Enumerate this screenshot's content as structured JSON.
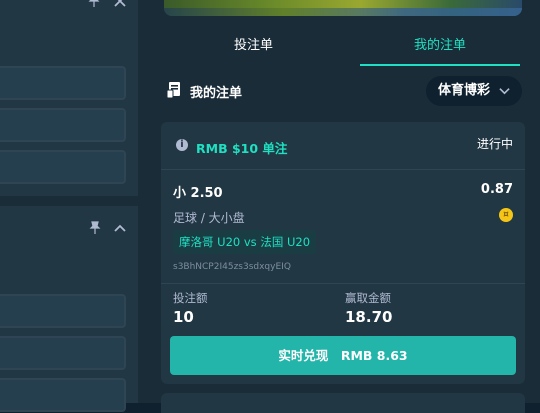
{
  "tabs": {
    "place_bet": "投注单",
    "my_bets": "我的注单"
  },
  "my_bets_header": {
    "label": "我的注单",
    "icon": "receipt-icon"
  },
  "filter": {
    "selected": "体育博彩"
  },
  "bet_card": {
    "title": "RMB $10 单注",
    "status": "进行中",
    "selection": "小 2.50",
    "odds": "0.87",
    "sport_market": "足球 / 大小盘",
    "match": "摩洛哥 U20 vs 法国 U20",
    "bet_id": "s3BhNCP2I45zs3sdxqyEIQ",
    "stake_label": "投注额",
    "stake_value": "10",
    "win_label": "赢取金额",
    "win_value": "18.70",
    "cashout_label": "实时兑现　RMB 8.63"
  },
  "colors": {
    "accent": "#1fe0c2",
    "cashout": "#23b5a9",
    "panel": "#213743",
    "background": "#1a2c38"
  }
}
